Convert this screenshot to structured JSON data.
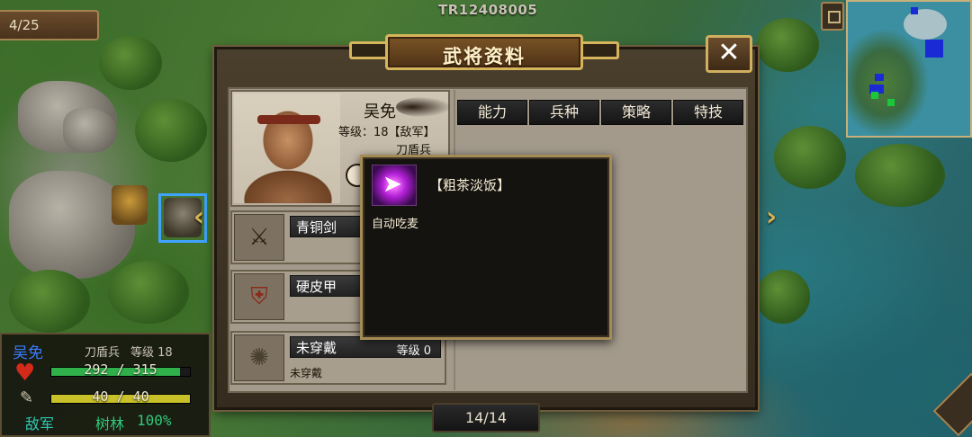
{
  "session_code": "TR12408005",
  "turn": "4/25",
  "dialog": {
    "title": "武将资料",
    "close_label": "✕"
  },
  "hero": {
    "name": "吴免",
    "level_text": "等级：18【敌军】",
    "unit_type": "刀盾兵"
  },
  "equipment": [
    {
      "name": "青铜剑",
      "icon": "sword-icon",
      "level": "",
      "sub": ""
    },
    {
      "name": "硬皮甲",
      "icon": "armor-icon",
      "level": "",
      "sub": ""
    },
    {
      "name": "未穿戴",
      "icon": "accessory-slot-icon",
      "level": "等级 0",
      "sub": "未穿戴"
    }
  ],
  "tabs": [
    {
      "label": "能力"
    },
    {
      "label": "兵种"
    },
    {
      "label": "策略"
    },
    {
      "label": "特技"
    }
  ],
  "tooltip": {
    "skill_name": "【粗茶淡饭】",
    "skill_desc": "自动吃麦",
    "icon": "skill-arrow-icon"
  },
  "page_indicator": "14/14",
  "unit_info": {
    "name": "吴免",
    "type": "刀盾兵",
    "level": "等级 18",
    "hp_text": "292 / 315",
    "hp_current": 292,
    "hp_max": 315,
    "mp_text": "40 / 40",
    "mp_current": 40,
    "mp_max": 40,
    "side": "敌军",
    "terrain": "树林",
    "terrain_bonus": "100%"
  },
  "colors": {
    "hp_bar": "#2fb04a",
    "mp_bar": "#c9c12a",
    "frame_gold": "#d6b45c",
    "ally_blue": "#1a2bd6",
    "enemy_green": "#1ac63a"
  }
}
